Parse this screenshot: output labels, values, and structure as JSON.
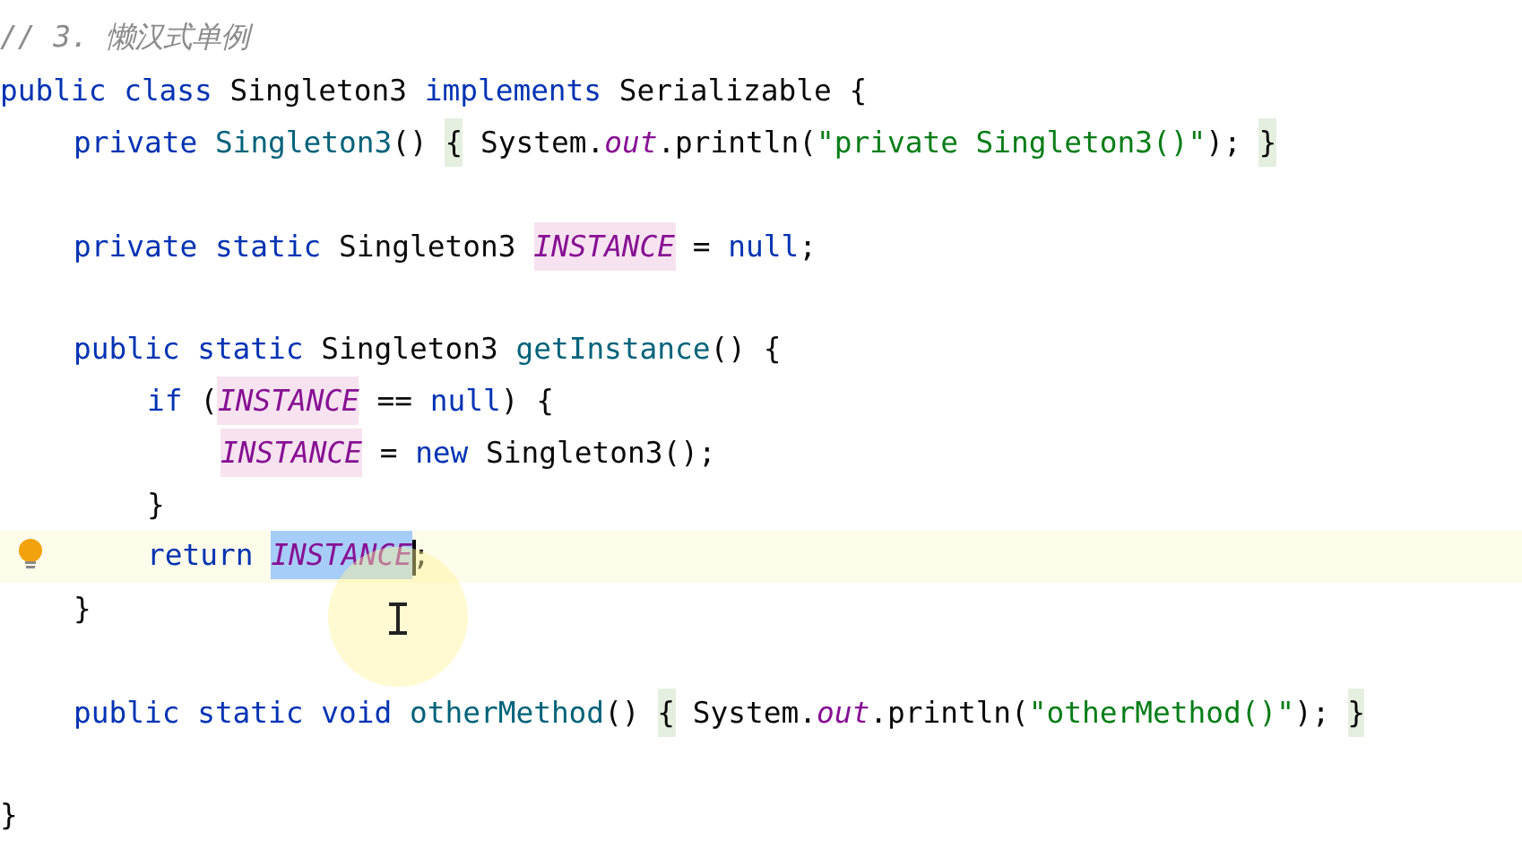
{
  "editor": {
    "lines": [
      {
        "kind": "code",
        "current": false,
        "tokens": [
          {
            "t": "// 3. 懒汉式单例",
            "kind": "comment"
          }
        ]
      },
      {
        "kind": "code",
        "current": false,
        "tokens": [
          {
            "t": "public class ",
            "kind": "keyword"
          },
          {
            "t": "Singleton3 ",
            "kind": "plain"
          },
          {
            "t": "implements ",
            "kind": "keyword"
          },
          {
            "t": "Serializable {",
            "kind": "plain"
          }
        ],
        "children": [
          {
            "kind": "code",
            "current": false,
            "tokens": [
              {
                "t": "private ",
                "kind": "keyword"
              },
              {
                "t": "Singleton3",
                "kind": "method"
              },
              {
                "t": "() ",
                "kind": "plain"
              },
              {
                "t": "{",
                "kind": "fold"
              },
              {
                "t": " System.",
                "kind": "plain"
              },
              {
                "t": "out",
                "kind": "field"
              },
              {
                "t": ".println(",
                "kind": "plain"
              },
              {
                "t": "\"private Singleton3()\"",
                "kind": "string"
              },
              {
                "t": "); ",
                "kind": "plain"
              },
              {
                "t": "}",
                "kind": "fold"
              }
            ]
          },
          {
            "kind": "blank",
            "current": false
          },
          {
            "kind": "code",
            "current": false,
            "tokens": [
              {
                "t": "private static ",
                "kind": "keyword"
              },
              {
                "t": "Singleton3 ",
                "kind": "plain"
              },
              {
                "t": "INSTANCE",
                "kind": "usage"
              },
              {
                "t": " = ",
                "kind": "plain"
              },
              {
                "t": "null",
                "kind": "keyword"
              },
              {
                "t": ";",
                "kind": "plain"
              }
            ]
          },
          {
            "kind": "blank",
            "current": false
          },
          {
            "kind": "code",
            "current": false,
            "tokens": [
              {
                "t": "public static ",
                "kind": "keyword"
              },
              {
                "t": "Singleton3 ",
                "kind": "plain"
              },
              {
                "t": "getInstance",
                "kind": "method"
              },
              {
                "t": "() {",
                "kind": "plain"
              }
            ],
            "children": [
              {
                "kind": "code",
                "current": false,
                "tokens": [
                  {
                    "t": "if ",
                    "kind": "keyword"
                  },
                  {
                    "t": "(",
                    "kind": "plain"
                  },
                  {
                    "t": "INSTANCE",
                    "kind": "usage"
                  },
                  {
                    "t": " == ",
                    "kind": "plain"
                  },
                  {
                    "t": "null",
                    "kind": "keyword"
                  },
                  {
                    "t": ") {",
                    "kind": "plain"
                  }
                ],
                "children": [
                  {
                    "kind": "code",
                    "current": false,
                    "tokens": [
                      {
                        "t": "INSTANCE",
                        "kind": "usage"
                      },
                      {
                        "t": " = ",
                        "kind": "plain"
                      },
                      {
                        "t": "new ",
                        "kind": "keyword"
                      },
                      {
                        "t": "Singleton3();",
                        "kind": "plain"
                      }
                    ]
                  }
                ]
              },
              {
                "kind": "code",
                "current": false,
                "tokens": [
                  {
                    "t": "}",
                    "kind": "plain"
                  }
                ]
              },
              {
                "kind": "code",
                "current": true,
                "tokens": [
                  {
                    "t": "return ",
                    "kind": "keyword"
                  },
                  {
                    "t": "INSTANCE",
                    "kind": "selection"
                  },
                  {
                    "t": ";",
                    "kind": "plain"
                  }
                ]
              }
            ]
          },
          {
            "kind": "code",
            "current": false,
            "tokens": [
              {
                "t": "}",
                "kind": "plain"
              }
            ]
          },
          {
            "kind": "blank",
            "current": false
          },
          {
            "kind": "code",
            "current": false,
            "tokens": [
              {
                "t": "public static void ",
                "kind": "keyword"
              },
              {
                "t": "otherMethod",
                "kind": "method"
              },
              {
                "t": "() ",
                "kind": "plain"
              },
              {
                "t": "{",
                "kind": "fold"
              },
              {
                "t": " System.",
                "kind": "plain"
              },
              {
                "t": "out",
                "kind": "field"
              },
              {
                "t": ".println(",
                "kind": "plain"
              },
              {
                "t": "\"otherMethod()\"",
                "kind": "string"
              },
              {
                "t": "); ",
                "kind": "plain"
              },
              {
                "t": "}",
                "kind": "fold"
              }
            ]
          },
          {
            "kind": "blank",
            "current": false
          }
        ]
      },
      {
        "kind": "code",
        "current": false,
        "tokens": [
          {
            "t": "}",
            "kind": "plain"
          }
        ]
      }
    ]
  }
}
